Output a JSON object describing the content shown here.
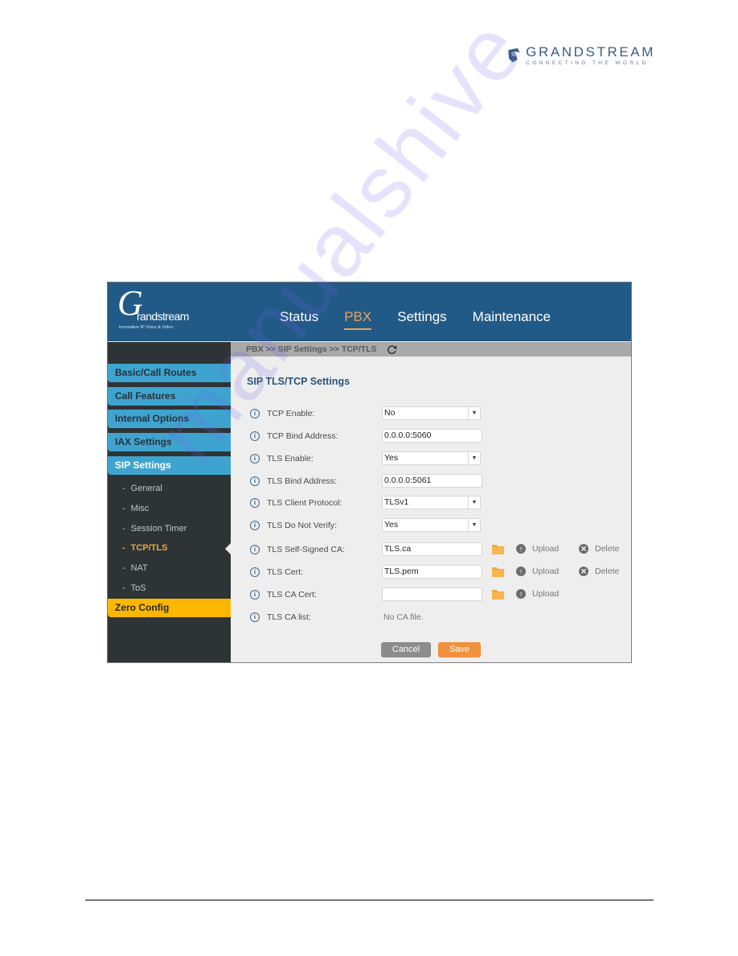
{
  "page": {
    "brand": {
      "name": "GRANDSTREAM",
      "tagline": "CONNECTING THE WORLD",
      "colors": {
        "primary": "#3c5c87"
      }
    },
    "watermark": "manualshive"
  },
  "app": {
    "logo": {
      "script_letter": "G",
      "word": "randstream",
      "subtitle": "Innovative IP Voice & Video"
    },
    "main_nav": [
      {
        "label": "Status",
        "active": false
      },
      {
        "label": "PBX",
        "active": true
      },
      {
        "label": "Settings",
        "active": false
      },
      {
        "label": "Maintenance",
        "active": false
      }
    ],
    "colors": {
      "header": "#215a87",
      "accent": "#e7a15a",
      "sidebar_bg": "#2e3435",
      "sidebar_item": "#3ea4cf",
      "sidebar_highlight": "#fcb700",
      "save_button": "#f0913e",
      "cancel_button": "#8c8c8c"
    },
    "sidebar": {
      "items": [
        {
          "label": "Basic/Call Routes",
          "active": false
        },
        {
          "label": "Call Features",
          "active": false
        },
        {
          "label": "Internal Options",
          "active": false
        },
        {
          "label": "IAX Settings",
          "active": false
        },
        {
          "label": "SIP Settings",
          "active": true
        }
      ],
      "sub_items": [
        {
          "label": "General",
          "active": false
        },
        {
          "label": "Misc",
          "active": false
        },
        {
          "label": "Session Timer",
          "active": false
        },
        {
          "label": "TCP/TLS",
          "active": true
        },
        {
          "label": "NAT",
          "active": false
        },
        {
          "label": "ToS",
          "active": false
        }
      ],
      "zero_config": {
        "label": "Zero Config"
      },
      "sub_dash": "-"
    },
    "breadcrumb": "PBX >> SIP Settings >> TCP/TLS",
    "section_title": "SIP TLS/TCP Settings",
    "fields": [
      {
        "label": "TCP Enable:",
        "type": "select",
        "value": "No"
      },
      {
        "label": "TCP Bind Address:",
        "type": "text",
        "value": "0.0.0.0:5060"
      },
      {
        "label": "TLS Enable:",
        "type": "select",
        "value": "Yes"
      },
      {
        "label": "TLS Bind Address:",
        "type": "text",
        "value": "0.0.0.0:5061"
      },
      {
        "label": "TLS Client Protocol:",
        "type": "select",
        "value": "TLSv1"
      },
      {
        "label": "TLS Do Not Verify:",
        "type": "select",
        "value": "Yes"
      },
      {
        "label": "TLS Self-Signed CA:",
        "type": "file",
        "value": "TLS.ca",
        "upload": "Upload",
        "delete": "Delete"
      },
      {
        "label": "TLS Cert:",
        "type": "file",
        "value": "TLS.pem",
        "upload": "Upload",
        "delete": "Delete"
      },
      {
        "label": "TLS CA Cert:",
        "type": "file",
        "value": "",
        "upload": "Upload"
      },
      {
        "label": "TLS CA list:",
        "type": "static",
        "value": "No CA file."
      }
    ],
    "icons": {
      "info": "i",
      "caret": "▼",
      "upload": "↑",
      "delete": "✕"
    },
    "buttons": {
      "cancel": "Cancel",
      "save": "Save"
    }
  }
}
